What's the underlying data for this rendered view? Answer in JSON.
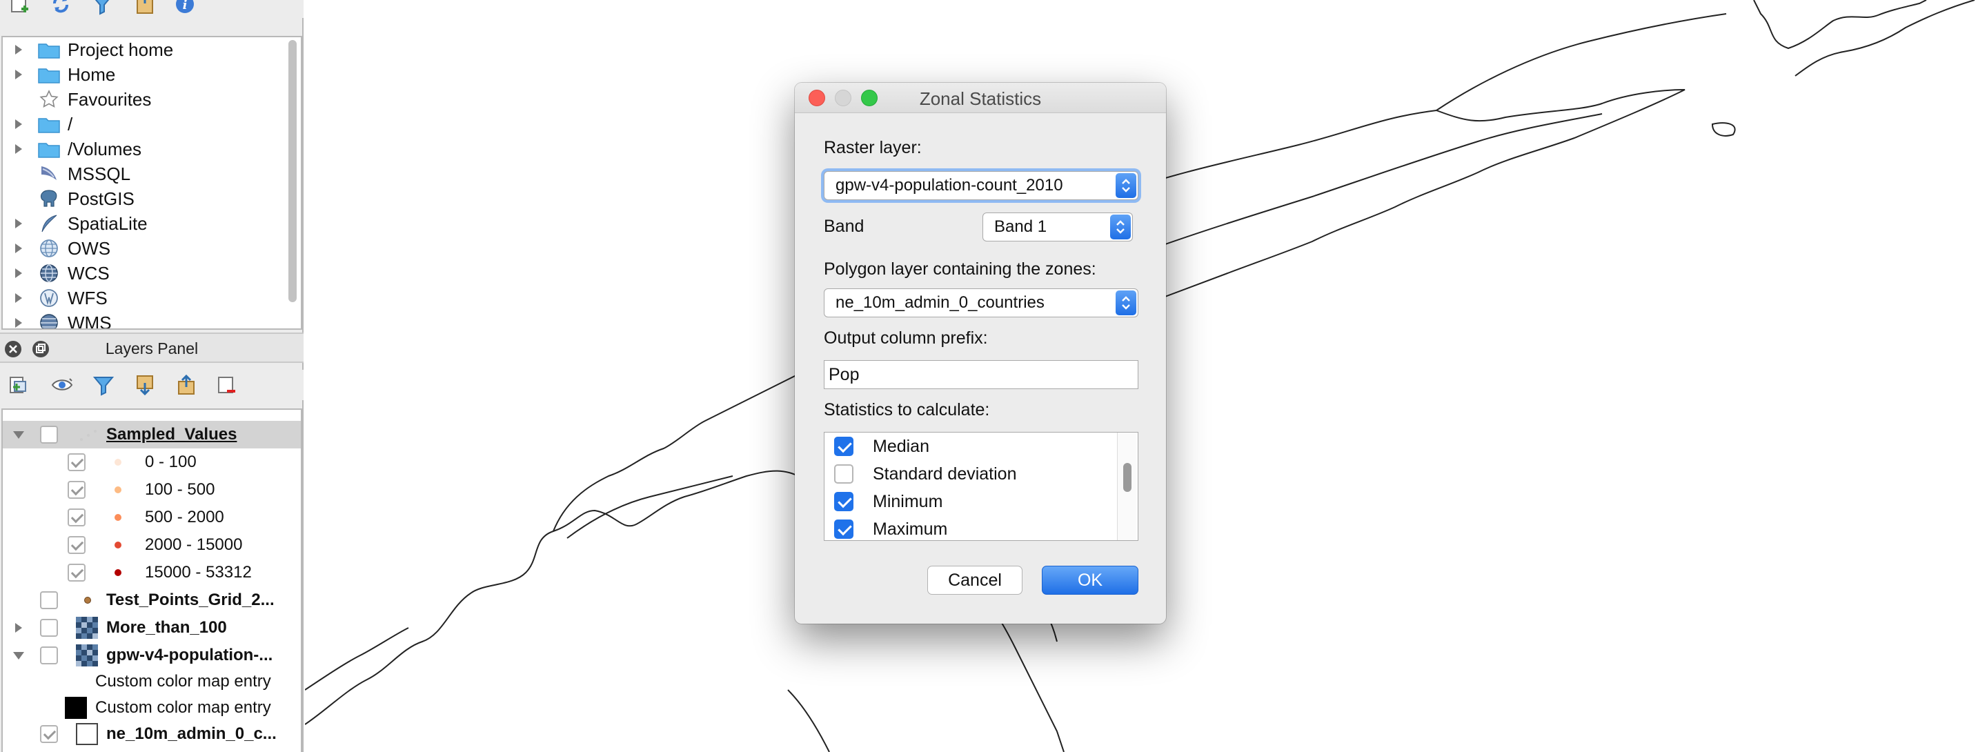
{
  "browser": {
    "items": [
      {
        "label": "Project home",
        "icon": "folder-icon",
        "expandable": true
      },
      {
        "label": "Home",
        "icon": "folder-icon",
        "expandable": true
      },
      {
        "label": "Favourites",
        "icon": "star-icon",
        "expandable": false
      },
      {
        "label": "/",
        "icon": "folder-icon",
        "expandable": true
      },
      {
        "label": "/Volumes",
        "icon": "folder-icon",
        "expandable": true
      },
      {
        "label": "MSSQL",
        "icon": "mssql-icon",
        "expandable": false
      },
      {
        "label": "PostGIS",
        "icon": "postgis-elephant-icon",
        "expandable": false
      },
      {
        "label": "SpatiaLite",
        "icon": "spatialite-feather-icon",
        "expandable": true
      },
      {
        "label": "OWS",
        "icon": "globe-icon",
        "expandable": true
      },
      {
        "label": "WCS",
        "icon": "globe-icon",
        "expandable": true
      },
      {
        "label": "WFS",
        "icon": "globe-icon",
        "expandable": true
      },
      {
        "label": "WMS",
        "icon": "globe-icon",
        "expandable": true
      }
    ]
  },
  "layers_panel": {
    "title": "Layers Panel",
    "layers": {
      "sampled_values": {
        "name": "Sampled_Values"
      },
      "classes": [
        {
          "label": "0 - 100",
          "color": "#fde6d6"
        },
        {
          "label": "100 - 500",
          "color": "#fdbb84"
        },
        {
          "label": "500 - 2000",
          "color": "#fc8d59"
        },
        {
          "label": "2000 - 15000",
          "color": "#e34a33"
        },
        {
          "label": "15000 - 53312",
          "color": "#b30000"
        }
      ],
      "test_points": {
        "name": "Test_Points_Grid_2..."
      },
      "more_than_100": {
        "name": "More_than_100"
      },
      "gpw": {
        "name": "gpw-v4-population-..."
      },
      "color_entries": [
        {
          "label": "Custom color map entry",
          "color": "#ffffff"
        },
        {
          "label": "Custom color map entry",
          "color": "#000000"
        }
      ],
      "countries": {
        "name": "ne_10m_admin_0_c..."
      }
    }
  },
  "dialog": {
    "title": "Zonal Statistics",
    "raster_label": "Raster layer:",
    "raster_value": "gpw-v4-population-count_2010",
    "band_label": "Band",
    "band_value": "Band 1",
    "polygon_label": "Polygon layer containing the zones:",
    "polygon_value": "ne_10m_admin_0_countries",
    "prefix_label": "Output column prefix:",
    "prefix_value": "Pop",
    "stats_label": "Statistics to calculate:",
    "stats": [
      {
        "label": "Median",
        "checked": true
      },
      {
        "label": "Standard deviation",
        "checked": false
      },
      {
        "label": "Minimum",
        "checked": true
      },
      {
        "label": "Maximum",
        "checked": true
      }
    ],
    "cancel_label": "Cancel",
    "ok_label": "OK"
  },
  "colors": {
    "accent": "#1f6fe6",
    "close": "#fc5f57",
    "zoom": "#34c84a",
    "folder": "#5bb8f0"
  }
}
